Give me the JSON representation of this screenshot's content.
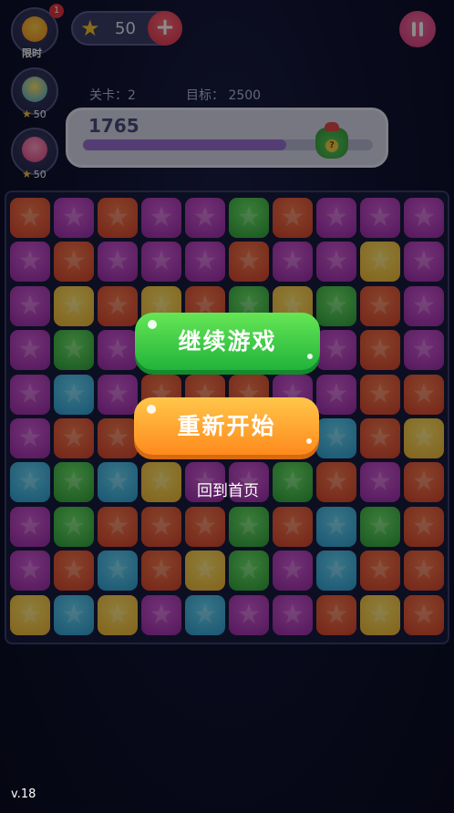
{
  "side": {
    "limited_label": "限时",
    "limited_badge": "1",
    "hammer_cost": "50",
    "candy_cost": "50"
  },
  "coins": {
    "value": "50",
    "plus": "+"
  },
  "level": {
    "label": "关卡：2",
    "target": "目标： 2500"
  },
  "score": {
    "value": "1765",
    "progress": 0.7
  },
  "board": {
    "rows": [
      [
        "o",
        "p",
        "o",
        "p",
        "p",
        "g",
        "o",
        "p",
        "p",
        "p"
      ],
      [
        "p",
        "o",
        "p",
        "p",
        "p",
        "o",
        "p",
        "p",
        "y",
        "p"
      ],
      [
        "p",
        "y",
        "o",
        "y",
        "o",
        "g",
        "y",
        "g",
        "o",
        "p"
      ],
      [
        "p",
        "g",
        "p",
        "o",
        "o",
        "o",
        "p",
        "p",
        "o",
        "p"
      ],
      [
        "p",
        "b",
        "p",
        "o",
        "o",
        "o",
        "p",
        "p",
        "o",
        "o"
      ],
      [
        "p",
        "o",
        "o",
        "p",
        "p",
        "o",
        "o",
        "b",
        "o",
        "y"
      ],
      [
        "b",
        "g",
        "b",
        "y",
        "p",
        "p",
        "g",
        "o",
        "p",
        "o"
      ],
      [
        "p",
        "g",
        "o",
        "o",
        "o",
        "g",
        "o",
        "b",
        "g",
        "o"
      ],
      [
        "p",
        "o",
        "b",
        "o",
        "y",
        "g",
        "p",
        "b",
        "o",
        "o"
      ],
      [
        "y",
        "b",
        "y",
        "p",
        "b",
        "p",
        "p",
        "o",
        "y",
        "o"
      ]
    ]
  },
  "dialog": {
    "continue_label": "继续游戏",
    "restart_label": "重新开始",
    "home_label": "回到首页"
  },
  "footer": {
    "version": "v.18"
  },
  "colors": {
    "orange": "#e65a3a",
    "purple": "#b53fbe",
    "green": "#3cbf45",
    "yellow": "#f7c531",
    "blue": "#3fb2e0"
  }
}
